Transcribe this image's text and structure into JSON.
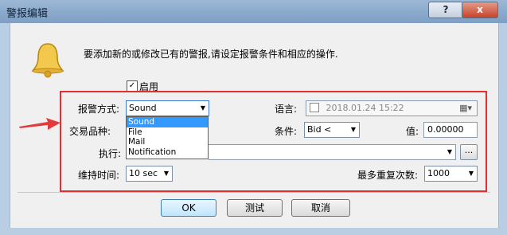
{
  "window": {
    "title": "警报编辑",
    "help_label": "?",
    "close_label": "x"
  },
  "intro_text": "要添加新的或修改已有的警报,请设定报警条件和相应的操作.",
  "enable": {
    "label": "启用",
    "checked_mark": "✓"
  },
  "alert_method": {
    "label": "报警方式:",
    "value": "Sound",
    "options": [
      "Sound",
      "File",
      "Mail",
      "Notification"
    ]
  },
  "symbol": {
    "label": "交易品种:"
  },
  "language": {
    "label": "语言:",
    "datetime": "2018.01.24 15:22",
    "calendar_icon": "calendar-icon"
  },
  "condition": {
    "label": "条件:",
    "value": "Bid <"
  },
  "value": {
    "label": "值:",
    "value": "0.00000"
  },
  "execute": {
    "label": "执行:",
    "value": "",
    "browse_label": "..."
  },
  "hold_time": {
    "label": "维持时间:",
    "value": "10 sec"
  },
  "max_repeat": {
    "label": "最多重复次数:",
    "value": "1000"
  },
  "buttons": {
    "ok": "OK",
    "test": "测试",
    "cancel": "取消"
  },
  "colors": {
    "highlight_box": "#e03030",
    "selected_option": "#3399ff"
  }
}
